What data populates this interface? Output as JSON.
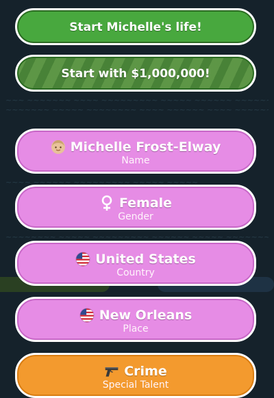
{
  "buttons": {
    "start_life": "Start Michelle's life!",
    "start_million": "Start with $1,000,000!"
  },
  "fields": [
    {
      "title": "Michelle Frost-Elway",
      "subtitle": "Name",
      "icon": "person-face-icon"
    },
    {
      "title": "Female",
      "subtitle": "Gender",
      "icon": "female-symbol-icon"
    },
    {
      "title": "United States",
      "subtitle": "Country",
      "icon": "us-flag-icon"
    },
    {
      "title": "New Orleans",
      "subtitle": "Place",
      "icon": "us-flag-icon"
    },
    {
      "title": "Crime",
      "subtitle": "Special Talent",
      "icon": "pistol-icon"
    }
  ],
  "colors": {
    "green": "#48a83e",
    "pink": "#e68ce5",
    "orange": "#f39a2e",
    "background": "#15222b"
  }
}
